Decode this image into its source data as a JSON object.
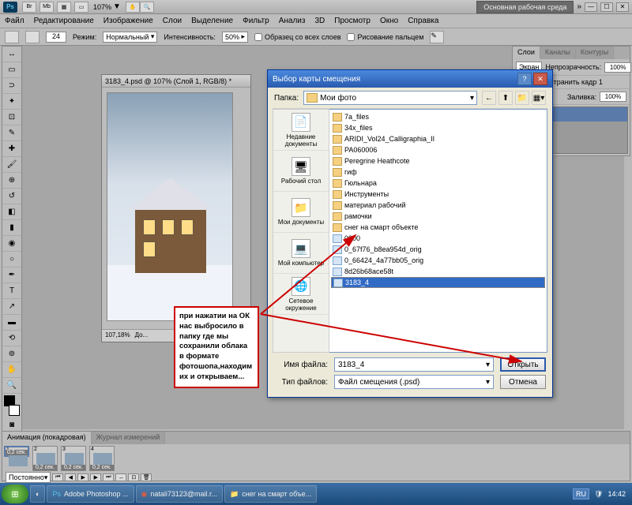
{
  "app": {
    "logo": "Ps",
    "zoom_top": "107%"
  },
  "top_right": {
    "workspace": "Основная рабочая среда"
  },
  "menu": [
    "Файл",
    "Редактирование",
    "Изображение",
    "Слои",
    "Выделение",
    "Фильтр",
    "Анализ",
    "3D",
    "Просмотр",
    "Окно",
    "Справка"
  ],
  "options": {
    "brush_size": "24",
    "mode_label": "Режим:",
    "mode_value": "Нормальный",
    "intensity_label": "Интенсивность:",
    "intensity_value": "50%",
    "sample_all": "Образец со всех слоев",
    "finger": "Рисование пальцем"
  },
  "doc": {
    "title": "3183_4.psd @ 107% (Слой 1, RGB/8) *",
    "status_zoom": "107,18%",
    "status_doc": "До..."
  },
  "panels": {
    "tabs": [
      "Слои",
      "Каналы",
      "Контуры"
    ],
    "mode": "Экран",
    "opacity_label": "Непрозрачность:",
    "opacity": "100%",
    "fill_label": "Заливка:",
    "fill": "100%",
    "propagate": "Распространить кадр 1"
  },
  "animation": {
    "tabs": [
      "Анимация (покадровая)",
      "Журнал измерений"
    ],
    "frames": [
      {
        "n": "1",
        "sec": "0,2 сек.",
        "sel": true
      },
      {
        "n": "2",
        "sec": "0,2 сек."
      },
      {
        "n": "3",
        "sec": "0,2 сек."
      },
      {
        "n": "4",
        "sec": "0,2 сек."
      }
    ],
    "loop": "Постоянно"
  },
  "dialog": {
    "title": "Выбор карты смещения",
    "folder_label": "Папка:",
    "folder_value": "Мои фото",
    "places": [
      "Недавние документы",
      "Рабочий стол",
      "Мои документы",
      "Мой компьютер",
      "Сетевое окружение"
    ],
    "files": [
      {
        "name": "7a_files",
        "type": "folder"
      },
      {
        "name": "34x_files",
        "type": "folder"
      },
      {
        "name": "ARIDI_Vol24_Calligraphia_II",
        "type": "folder"
      },
      {
        "name": "PA060006",
        "type": "folder"
      },
      {
        "name": "Peregrine Heathcote",
        "type": "folder"
      },
      {
        "name": "гиф",
        "type": "folder"
      },
      {
        "name": "Гюльнара",
        "type": "folder"
      },
      {
        "name": "Инструменты",
        "type": "folder"
      },
      {
        "name": "материал рабочий",
        "type": "folder"
      },
      {
        "name": "рамочки",
        "type": "folder"
      },
      {
        "name": "снег на смарт объекте",
        "type": "folder"
      },
      {
        "name": "0000",
        "type": "file"
      },
      {
        "name": "0_67f76_b8ea954d_orig",
        "type": "file"
      },
      {
        "name": "0_66424_4a77bb05_orig",
        "type": "file"
      },
      {
        "name": "8d26b68ace58t",
        "type": "file"
      },
      {
        "name": "3183_4",
        "type": "file",
        "sel": true
      }
    ],
    "filename_label": "Имя файла:",
    "filename_value": "3183_4",
    "filetype_label": "Тип файлов:",
    "filetype_value": "Файл смещения (.psd)",
    "open": "Открыть",
    "cancel": "Отмена"
  },
  "callout": "при нажатии на ОК нас выбросило в папку где мы сохранили облака в формате фотошопа,находим их и открываем...",
  "taskbar": {
    "tasks": [
      "Adobe Photoshop ...",
      "natali73123@mail.r...",
      "снег на смарт объе..."
    ],
    "lang": "RU",
    "time": "14:42"
  }
}
